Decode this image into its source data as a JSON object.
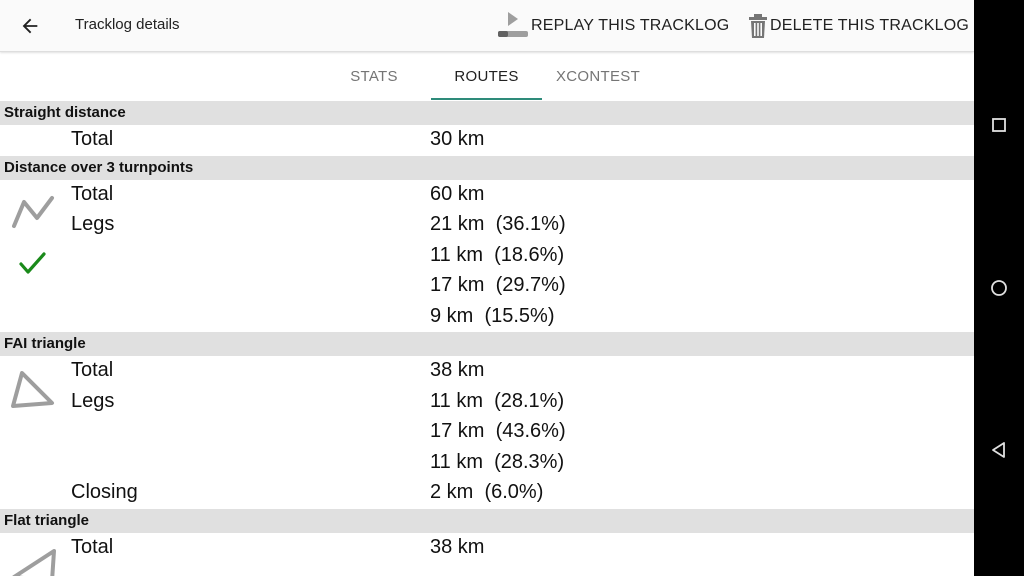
{
  "toolbar": {
    "title": "Tracklog details",
    "replay_label": "REPLAY THIS TRACKLOG",
    "delete_label": "DELETE THIS TRACKLOG",
    "back_icon": "arrow-back-icon",
    "replay_icon": "replay-icon",
    "delete_icon": "trash-icon"
  },
  "tabs": [
    {
      "label": "STATS",
      "active": false
    },
    {
      "label": "ROUTES",
      "active": true
    },
    {
      "label": "XCONTEST",
      "active": false
    }
  ],
  "colors": {
    "accent": "#2e8b7a",
    "check": "#1a8a1a",
    "section_bg": "#e0e0e0"
  },
  "sections": [
    {
      "title": "Straight distance",
      "rows": [
        {
          "label": "Total",
          "value": "30 km"
        }
      ]
    },
    {
      "title": "Distance over 3 turnpoints",
      "icon": "zigzag-route-icon",
      "status_icon": "check-icon",
      "rows": [
        {
          "label": "Total",
          "value": "60 km"
        },
        {
          "label": "Legs",
          "value": "21 km  (36.1%)"
        },
        {
          "label": "",
          "value": "11 km  (18.6%)"
        },
        {
          "label": "",
          "value": "17 km  (29.7%)"
        },
        {
          "label": "",
          "value": "9 km  (15.5%)"
        }
      ]
    },
    {
      "title": "FAI triangle",
      "icon": "triangle-icon",
      "rows": [
        {
          "label": "Total",
          "value": "38 km"
        },
        {
          "label": "Legs",
          "value": "11 km  (28.1%)"
        },
        {
          "label": "",
          "value": "17 km  (43.6%)"
        },
        {
          "label": "",
          "value": "11 km  (28.3%)"
        },
        {
          "label": "Closing",
          "value": "2 km  (6.0%)"
        }
      ]
    },
    {
      "title": "Flat triangle",
      "icon": "flat-triangle-icon",
      "rows": [
        {
          "label": "Total",
          "value": "38 km"
        }
      ]
    }
  ],
  "system_nav": {
    "recents_icon": "square-icon",
    "home_icon": "circle-icon",
    "back_icon": "triangle-back-icon"
  }
}
